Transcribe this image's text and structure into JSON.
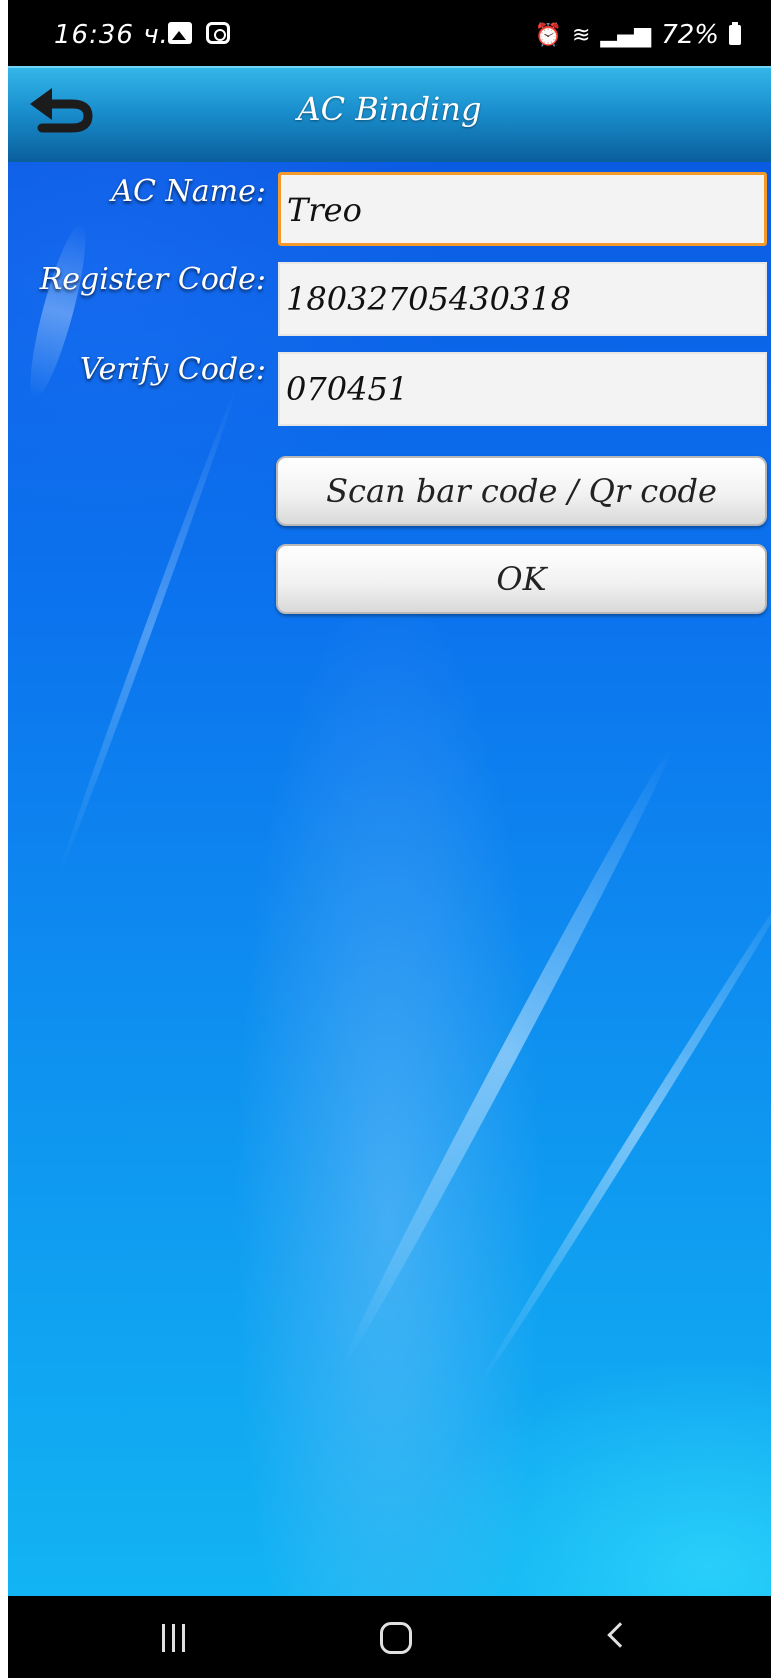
{
  "status_bar": {
    "time": "16:36 ч.",
    "right_text": "72%",
    "icons": [
      "gallery-icon",
      "camera-icon",
      "alarm-icon",
      "wifi-icon",
      "volte-icon",
      "signal-icon",
      "signal-icon",
      "battery-icon"
    ]
  },
  "header": {
    "title": "AC Binding",
    "back_icon": "undo-arrow-icon"
  },
  "form": {
    "ac_name": {
      "label": "AC Name:",
      "value": "Treo"
    },
    "register_code": {
      "label": "Register Code:",
      "value": "18032705430318"
    },
    "verify_code": {
      "label": "Verify Code:",
      "value": "070451"
    }
  },
  "buttons": {
    "scan": "Scan bar code / Qr code",
    "ok": "OK"
  },
  "nav_bar": {
    "icons": [
      "recent-apps-icon",
      "home-icon",
      "back-icon"
    ]
  },
  "colors": {
    "focus_border": "#f49a2a",
    "header_top": "#33b6e8",
    "background_top": "#0a56e0",
    "background_bottom": "#12b4f3"
  }
}
